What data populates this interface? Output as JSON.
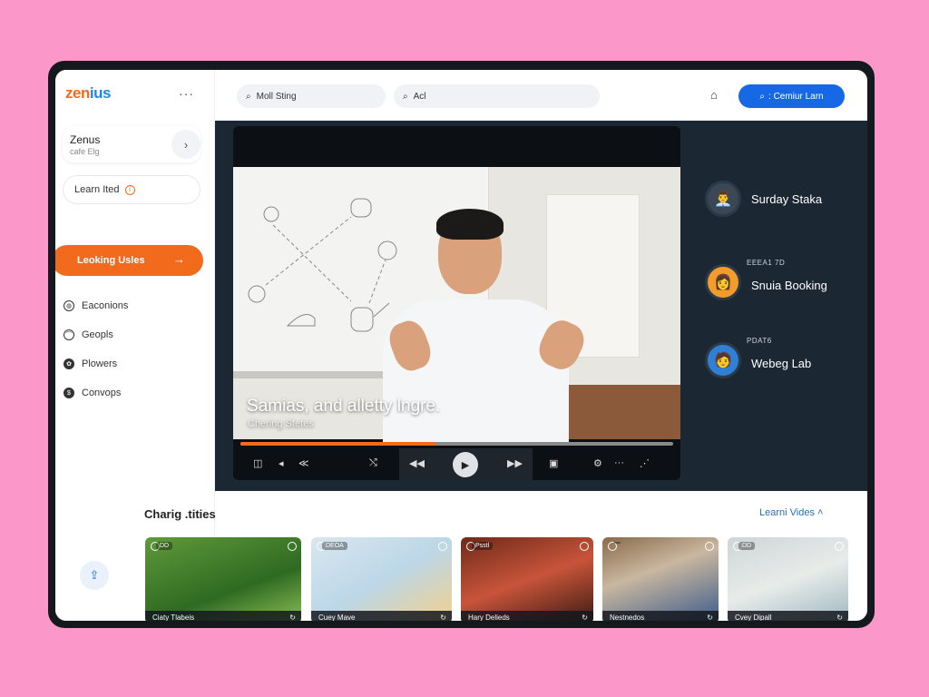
{
  "app": {
    "brand_a": "zen",
    "brand_b": "ius"
  },
  "sidebar": {
    "more_label": "···",
    "profile": {
      "name": "Zenus",
      "sub": "cafe Elg"
    },
    "learn_pill": "Learn Ited",
    "cta_label": "Leoking Usles",
    "nav": [
      {
        "label": "Eaconions",
        "icon": "globe-icon"
      },
      {
        "label": "Geopls",
        "icon": "people-icon"
      },
      {
        "label": "Plowers",
        "icon": "flower-icon"
      },
      {
        "label": "Convops",
        "icon": "dollar-icon"
      }
    ]
  },
  "topbar": {
    "search1": "Moll Sting",
    "search2": "Acl",
    "button_label": ": Cemiur Larn"
  },
  "video": {
    "caption": "Samias, and alletty lngre.",
    "caption_sub": "Chering Stetes",
    "progress": 0.45
  },
  "speakers": [
    {
      "tag": "",
      "name": "Surday Staka"
    },
    {
      "tag": "EEEA1 7D",
      "name": "Snuia Booking"
    },
    {
      "tag": "PDAT6",
      "name": "Webeg Lab"
    }
  ],
  "section": {
    "title": "Charig .tities",
    "link": "Learni Vides"
  },
  "thumbs": [
    {
      "tag": "DD",
      "label": "Ciaty Tlabeis"
    },
    {
      "tag": "DEOA",
      "label": "Cuey Mave"
    },
    {
      "tag": "Psstl",
      "label": "Hary Delieds"
    },
    {
      "tag": "",
      "label": "Nestnedos"
    },
    {
      "tag": "DD",
      "label": "Cvey Dipall"
    }
  ],
  "colors": {
    "accent": "#f26a1b",
    "primary": "#1768e5",
    "stage": "#1b2733",
    "background": "#fb97c9"
  }
}
